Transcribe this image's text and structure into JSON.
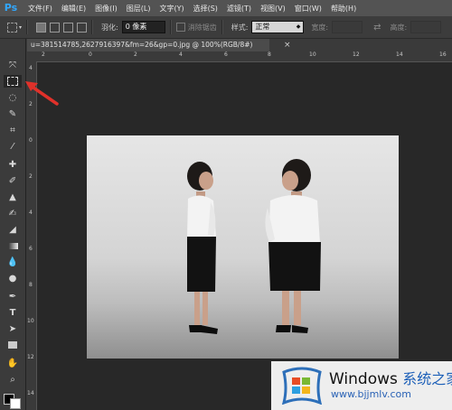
{
  "app": {
    "logo": "Ps"
  },
  "menu": [
    "文件(F)",
    "编辑(E)",
    "图像(I)",
    "图层(L)",
    "文字(Y)",
    "选择(S)",
    "滤镜(T)",
    "视图(V)",
    "窗口(W)",
    "帮助(H)"
  ],
  "options": {
    "feather_label": "羽化:",
    "feather_value": "0 像素",
    "antialias_label": "消除锯齿",
    "style_label": "样式:",
    "style_value": "正常",
    "width_label": "宽度:",
    "height_label": "高度:"
  },
  "document": {
    "tab_title": "u=381514785,2627916397&fm=26&gp=0.jpg @ 100%(RGB/8#)",
    "close_glyph": "×"
  },
  "ruler_top": [
    "2",
    "0",
    "2",
    "4",
    "6",
    "8",
    "10",
    "12",
    "14",
    "16"
  ],
  "ruler_left": [
    "4",
    "2",
    "0",
    "2",
    "4",
    "6",
    "8",
    "10",
    "12",
    "14"
  ],
  "tools": [
    "move-icon",
    "rect-marquee-icon",
    "lasso-icon",
    "quick-select-icon",
    "crop-icon",
    "eyedropper-icon",
    "healing-icon",
    "brush-icon",
    "stamp-icon",
    "history-brush-icon",
    "eraser-icon",
    "gradient-icon",
    "blur-icon",
    "dodge-icon",
    "pen-icon",
    "type-icon",
    "path-select-icon",
    "shape-icon",
    "hand-icon",
    "zoom-icon"
  ],
  "colors": {
    "annotation_arrow": "#e0312a",
    "ps_blue": "#31a8ff"
  },
  "watermark": {
    "title": "Windows",
    "title_cn": "系统之家",
    "url": "www.bjjmlv.com"
  }
}
